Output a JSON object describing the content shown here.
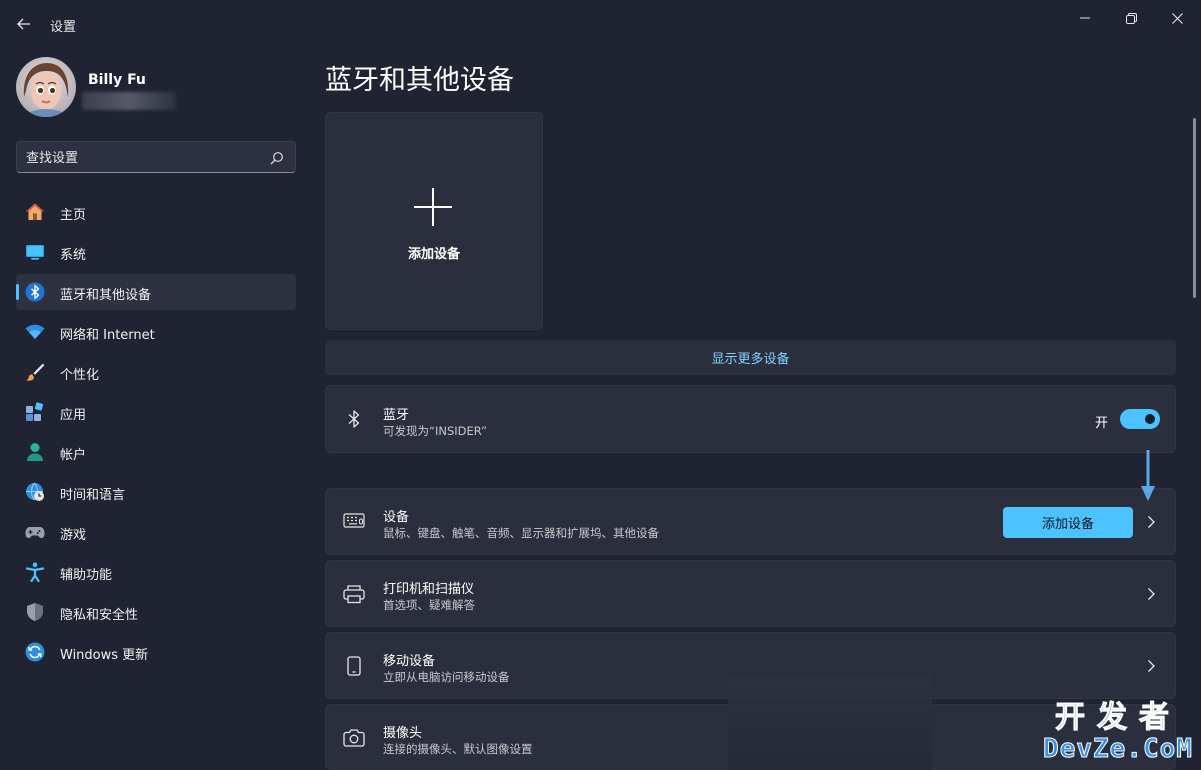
{
  "window": {
    "title": "设置",
    "back_icon": "back-arrow-icon",
    "controls": [
      "minimize-icon",
      "restore-icon",
      "close-icon"
    ]
  },
  "user": {
    "name": "Billy Fu"
  },
  "search": {
    "placeholder": "查找设置"
  },
  "sidebar": {
    "items": [
      {
        "label": "主页",
        "icon": "home-icon"
      },
      {
        "label": "系统",
        "icon": "system-icon"
      },
      {
        "label": "蓝牙和其他设备",
        "icon": "bluetooth-icon",
        "active": true
      },
      {
        "label": "网络和 Internet",
        "icon": "wifi-icon"
      },
      {
        "label": "个性化",
        "icon": "brush-icon"
      },
      {
        "label": "应用",
        "icon": "apps-icon"
      },
      {
        "label": "帐户",
        "icon": "account-icon"
      },
      {
        "label": "时间和语言",
        "icon": "globe-clock-icon"
      },
      {
        "label": "游戏",
        "icon": "gamepad-icon"
      },
      {
        "label": "辅助功能",
        "icon": "accessibility-icon"
      },
      {
        "label": "隐私和安全性",
        "icon": "shield-icon"
      },
      {
        "label": "Windows 更新",
        "icon": "update-icon"
      }
    ]
  },
  "main": {
    "title": "蓝牙和其他设备",
    "add_tile_label": "添加设备",
    "show_more_label": "显示更多设备",
    "bluetooth": {
      "title": "蓝牙",
      "subtitle": "可发现为“INSIDER”",
      "toggle_label": "开",
      "on": true
    },
    "cards": [
      {
        "title": "设备",
        "subtitle": "鼠标、键盘、触笔、音频、显示器和扩展坞、其他设备",
        "button_label": "添加设备",
        "icon": "keyboard-device-icon"
      },
      {
        "title": "打印机和扫描仪",
        "subtitle": "首选项、疑难解答",
        "icon": "printer-icon"
      },
      {
        "title": "移动设备",
        "subtitle": "立即从电脑访问移动设备",
        "icon": "phone-icon"
      },
      {
        "title": "摄像头",
        "subtitle": "连接的摄像头、默认图像设置",
        "icon": "camera-icon"
      }
    ]
  },
  "watermark": {
    "line1": "开发者",
    "line2": "DevZe.CoM"
  },
  "colors": {
    "accent": "#4cc2ff",
    "background": "#202432",
    "card": "#2b2f3d"
  }
}
